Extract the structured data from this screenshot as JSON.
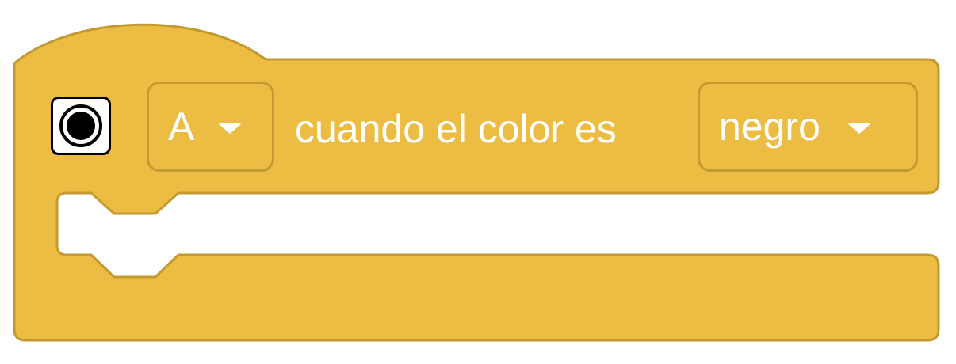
{
  "block": {
    "color": "#ecbd42",
    "border_color": "#c39a31",
    "sensor_icon": "color-sensor-icon",
    "port_value": "A",
    "text": "cuando el color es",
    "color_value": "negro",
    "caret_icon": "chevron-down-icon"
  }
}
